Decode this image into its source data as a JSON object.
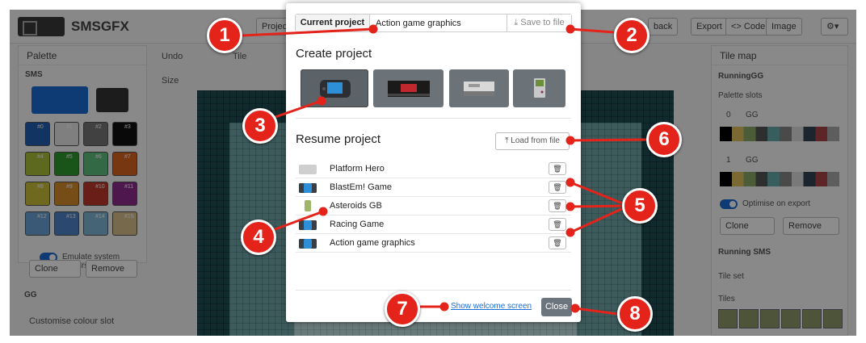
{
  "app": {
    "brand": "SMSGFX",
    "toolbar": {
      "project_btn": "Projec",
      "playback_btn": "back",
      "export_btn": "Export",
      "code_btn": "<> Code",
      "image_btn": "Image",
      "undo_label": "Undo",
      "tile_label": "Tile",
      "size_label": "Size"
    },
    "palette_panel": {
      "title": "Palette",
      "system": "SMS",
      "swatches": [
        {
          "label": "#0",
          "color": "#1f5fb5"
        },
        {
          "label": "#1",
          "color": "#e8e8e8"
        },
        {
          "label": "#2",
          "color": "#777777"
        },
        {
          "label": "#3",
          "color": "#111111"
        },
        {
          "label": "#4",
          "color": "#a8c03a"
        },
        {
          "label": "#5",
          "color": "#2e9b2e"
        },
        {
          "label": "#6",
          "color": "#5fbf7f"
        },
        {
          "label": "#7",
          "color": "#d9641f"
        },
        {
          "label": "#8",
          "color": "#c9c03a"
        },
        {
          "label": "#9",
          "color": "#d88a2a"
        },
        {
          "label": "#10",
          "color": "#c0392b"
        },
        {
          "label": "#11",
          "color": "#8e2a8e"
        },
        {
          "label": "#12",
          "color": "#6aa3d8"
        },
        {
          "label": "#13",
          "color": "#4f86c9"
        },
        {
          "label": "#14",
          "color": "#7fb8d8"
        },
        {
          "label": "#15",
          "color": "#d8c08a"
        }
      ],
      "emulate_label": "Emulate system colours",
      "clone_label": "Clone",
      "remove_label": "Remove",
      "gg_label": "GG",
      "customise_label": "Customise colour slot"
    },
    "tilemap_panel": {
      "title": "Tile map",
      "name": "RunningGG",
      "palette_slots_label": "Palette slots",
      "slot0": {
        "index": "0",
        "value": "GG"
      },
      "slot1": {
        "index": "1",
        "value": "GG"
      },
      "optimise_label": "Optimise on export",
      "clone_label": "Clone",
      "remove_label": "Remove",
      "running_sms": "Running SMS",
      "tileset_label": "Tile set",
      "tiles_label": "Tiles"
    }
  },
  "modal": {
    "current_project_label": "Current project",
    "current_project_value": "Action game graphics",
    "save_label": "Save to file",
    "create_heading": "Create project",
    "systems": [
      "Game Gear",
      "Master System",
      "NES",
      "Game Boy"
    ],
    "resume_heading": "Resume project",
    "load_label": "Load from file",
    "projects": [
      {
        "name": "Platform Hero",
        "system": "nes"
      },
      {
        "name": "BlastEm! Game",
        "system": "gg"
      },
      {
        "name": "Asteroids GB",
        "system": "gb"
      },
      {
        "name": "Racing Game",
        "system": "gg"
      },
      {
        "name": "Action game graphics",
        "system": "gg"
      }
    ],
    "welcome_link": "Show welcome screen",
    "close_label": "Close"
  },
  "annotations": [
    "1",
    "2",
    "3",
    "4",
    "5",
    "6",
    "7",
    "8"
  ],
  "colors": {
    "annotation_red": "#e4231b",
    "link_blue": "#1a6ed8",
    "close_button": "#6c757d"
  }
}
